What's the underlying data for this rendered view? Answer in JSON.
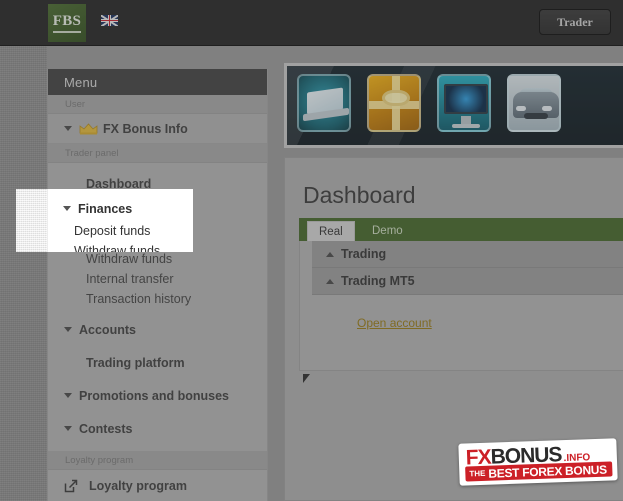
{
  "topbar": {
    "logo_text": "FBS",
    "logo_name": "fbs-logo",
    "flag": "uk-flag",
    "trader_button": "Trader"
  },
  "sidebar": {
    "menu_header": "Menu",
    "sections": [
      {
        "label": "User"
      },
      {
        "label": "Trader panel"
      },
      {
        "label": "Loyalty program"
      }
    ],
    "user_items": [
      {
        "label": "FX Bonus Info",
        "icon": "crown-icon",
        "caret": true
      }
    ],
    "trader_items": [
      {
        "label": "Dashboard",
        "caret": false
      },
      {
        "label": "Finances",
        "caret": true
      },
      {
        "label": "Deposit funds",
        "caret": false,
        "sub": true
      },
      {
        "label": "Withdraw funds",
        "caret": false,
        "sub": true
      },
      {
        "label": "Internal transfer",
        "caret": false,
        "sub": true
      },
      {
        "label": "Transaction history",
        "caret": false,
        "sub": true
      },
      {
        "label": "Accounts",
        "caret": true
      },
      {
        "label": "Trading platform",
        "caret": false
      },
      {
        "label": "Promotions and bonuses",
        "caret": true
      },
      {
        "label": "Contests",
        "caret": true
      }
    ],
    "loyalty_items": [
      {
        "label": "Loyalty program",
        "icon": "external-link-icon"
      }
    ]
  },
  "banner": {
    "name": "promo-carousel",
    "prizes": [
      "laptop",
      "gift-box",
      "imac",
      "car"
    ]
  },
  "main": {
    "page_title": "Dashboard",
    "tabs": [
      {
        "label": "Real",
        "active": true
      },
      {
        "label": "Demo",
        "active": false
      }
    ],
    "accordions": [
      {
        "label": "Trading",
        "expanded": true
      },
      {
        "label": "Trading MT5",
        "expanded": true
      }
    ],
    "open_account_link": "Open account"
  },
  "watermark": {
    "fx": "FX",
    "bonus": "BONUS",
    "info": ".INFO",
    "the": "THE",
    "best": "BEST FOREX BONUS"
  },
  "colors": {
    "topbar": "#262626",
    "brand_green": "#46682a",
    "page_bg": "#9a9a9a",
    "sidebar_bg": "#b4b4b4",
    "link_gold": "#9a7b16",
    "watermark_red": "#cc2027"
  }
}
